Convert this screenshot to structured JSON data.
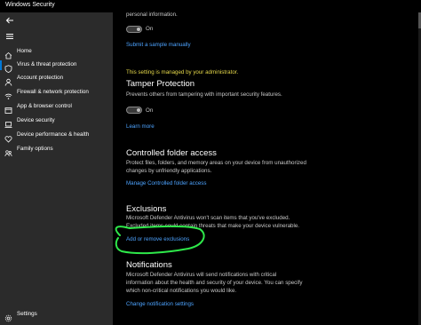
{
  "window": {
    "title": "Windows Security"
  },
  "sidebar": {
    "items": [
      {
        "label": "Home"
      },
      {
        "label": "Virus & threat protection"
      },
      {
        "label": "Account protection"
      },
      {
        "label": "Firewall & network protection"
      },
      {
        "label": "App & browser control"
      },
      {
        "label": "Device security"
      },
      {
        "label": "Device performance & health"
      },
      {
        "label": "Family options"
      }
    ],
    "settings_label": "Settings"
  },
  "main": {
    "top_text": "personal information.",
    "sample_toggle_state": "On",
    "submit_sample_link": "Submit a sample manually",
    "managed_notice": "This setting is managed by your administrator.",
    "tamper": {
      "title": "Tamper Protection",
      "description": "Prevents others from tampering with important security features.",
      "toggle_state": "On",
      "learn_more": "Learn more"
    },
    "cfa": {
      "title": "Controlled folder access",
      "desc_line1": "Protect files, folders, and memory areas on your device from unauthorized",
      "desc_line2": "changes by unfriendly applications.",
      "link": "Manage Controlled folder access"
    },
    "exclusions": {
      "title": "Exclusions",
      "desc_line1": "Microsoft Defender Antivirus won't scan items that you've excluded.",
      "desc_line2": "Excluded items could contain threats that make your device vulnerable.",
      "link": "Add or remove exclusions"
    },
    "notifications": {
      "title": "Notifications",
      "desc_line1": "Microsoft Defender Antivirus will send notifications with critical",
      "desc_line2": "information about the health and security of your device. You can specify",
      "desc_line3": "which non-critical notifications you would like.",
      "link": "Change notification settings"
    }
  },
  "colors": {
    "accent": "#0078d7",
    "link": "#4da3ff",
    "warning": "#e5d84a",
    "annotation": "#2ee84a",
    "sidebar_bg": "#2b2b2b"
  }
}
